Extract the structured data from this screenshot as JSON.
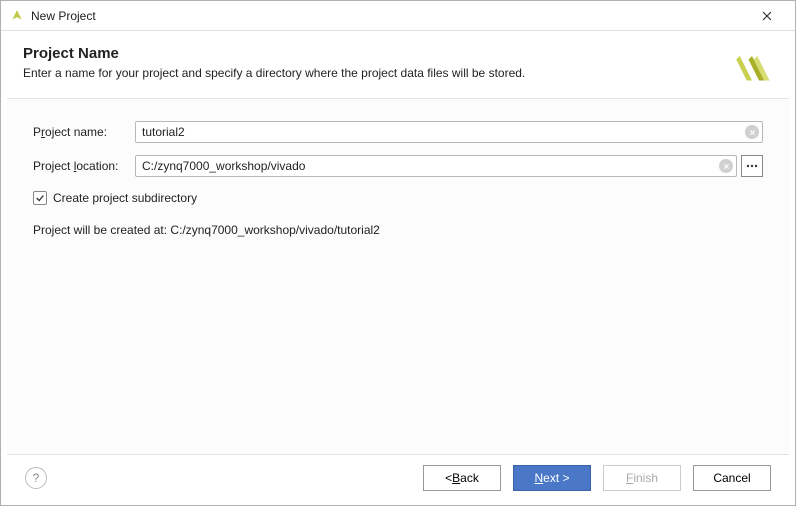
{
  "window": {
    "title": "New Project"
  },
  "header": {
    "heading": "Project Name",
    "subtitle": "Enter a name for your project and specify a directory where the project data files will be stored."
  },
  "form": {
    "project_name": {
      "label_pre": "P",
      "label_ul": "r",
      "label_post": "oject name:",
      "value": "tutorial2"
    },
    "project_location": {
      "label_pre": "Project ",
      "label_ul": "l",
      "label_post": "ocation:",
      "value": "C:/zynq7000_workshop/vivado"
    },
    "create_subdir": {
      "checked": true,
      "label": "Create project subdirectory"
    },
    "status_text": "Project will be created at: C:/zynq7000_workshop/vivado/tutorial2"
  },
  "footer": {
    "back": {
      "pre": "< ",
      "ul": "B",
      "post": "ack"
    },
    "next": {
      "ul": "N",
      "post": "ext >"
    },
    "finish": {
      "ul": "F",
      "post": "inish"
    },
    "cancel": "Cancel"
  }
}
